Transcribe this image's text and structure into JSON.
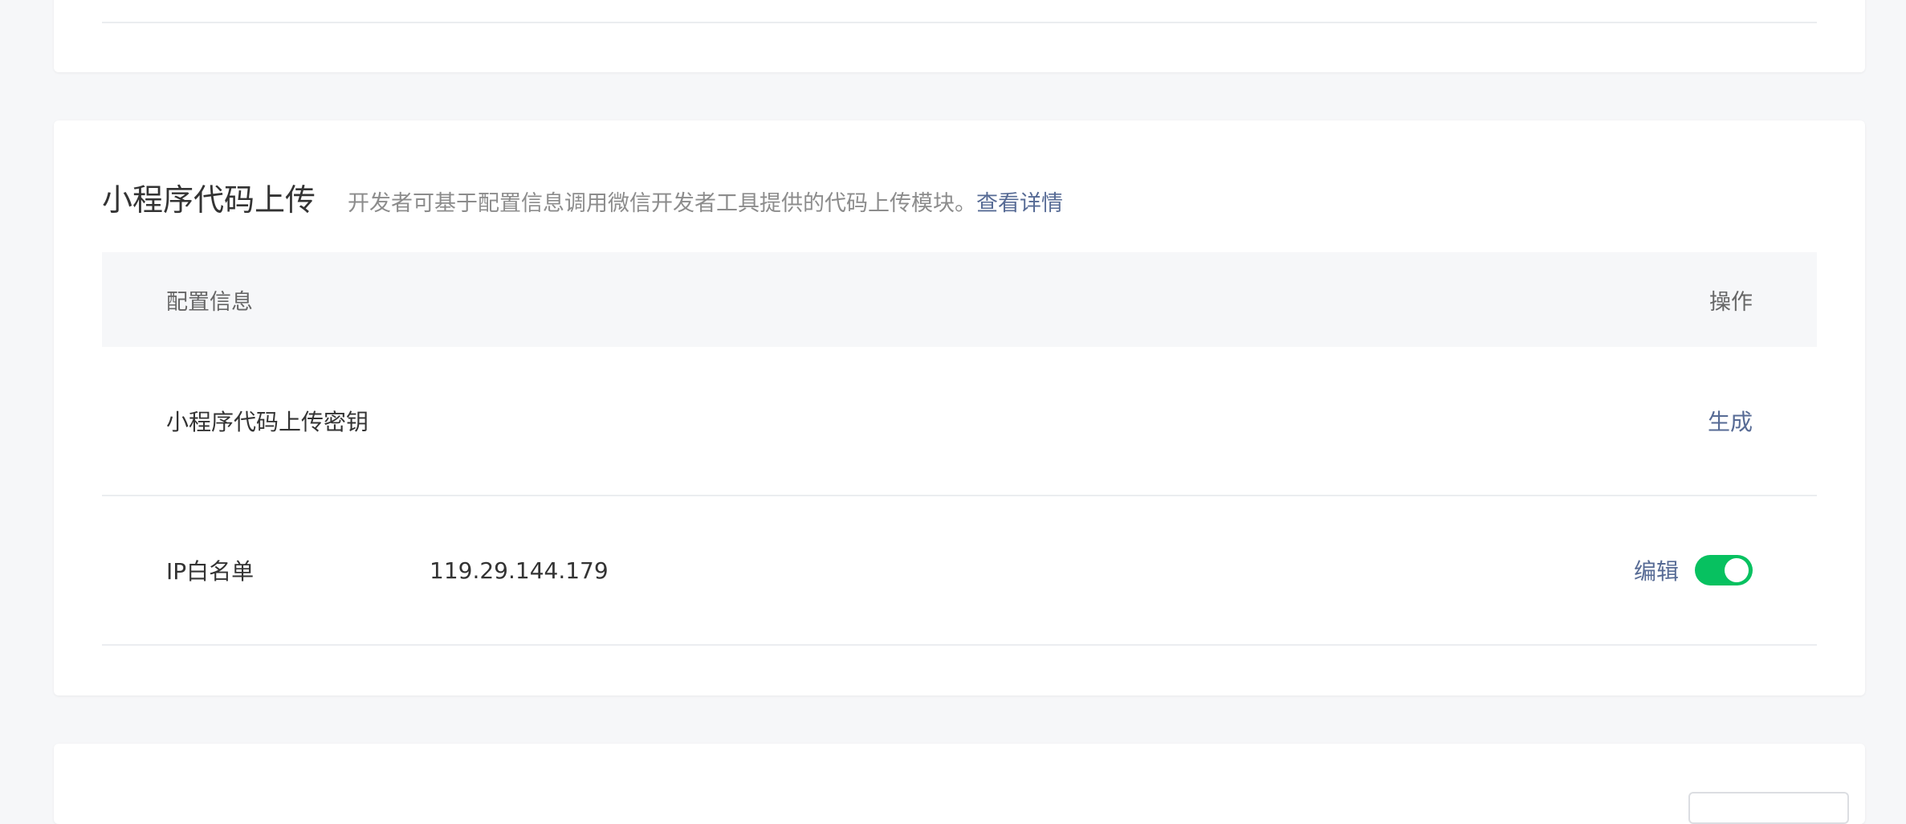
{
  "section": {
    "title": "小程序代码上传",
    "description": "开发者可基于配置信息调用微信开发者工具提供的代码上传模块。",
    "detail_link": "查看详情"
  },
  "table": {
    "header": {
      "config_info": "配置信息",
      "actions": "操作"
    },
    "rows": [
      {
        "label": "小程序代码上传密钥",
        "value": "",
        "action": "生成"
      },
      {
        "label": "IP白名单",
        "value": "119.29.144.179",
        "action": "编辑",
        "toggle_on": true
      }
    ]
  },
  "colors": {
    "accent_link": "#576b95",
    "toggle_on": "#07c160",
    "background": "#f6f7f9"
  }
}
